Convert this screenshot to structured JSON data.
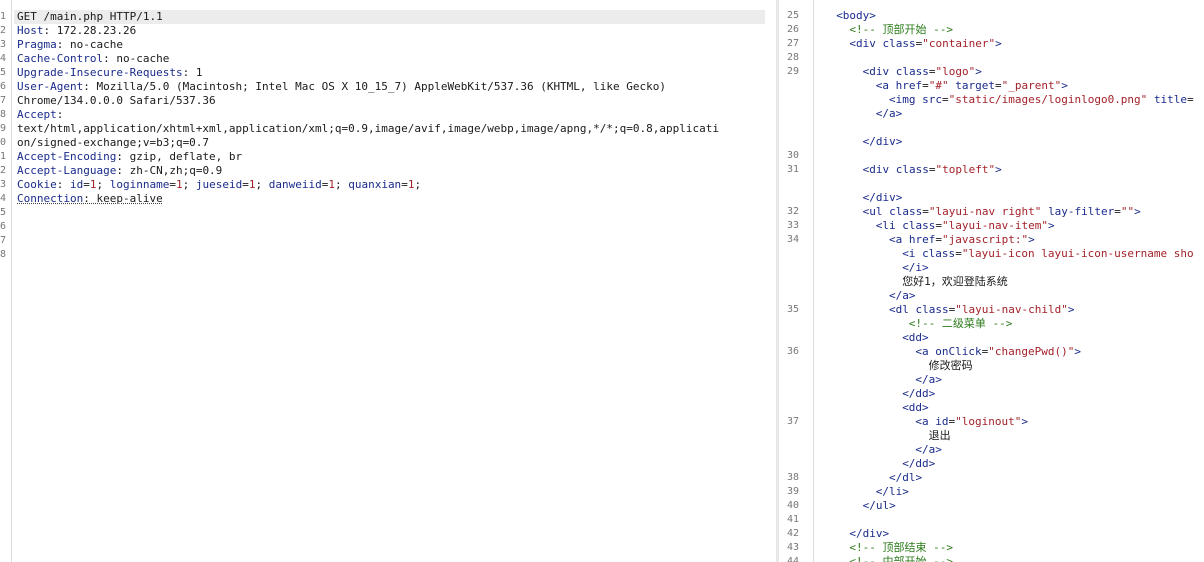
{
  "request": {
    "line_numbers": [
      "1",
      "2",
      "3",
      "4",
      "5",
      "6",
      "7",
      "8",
      "9",
      "0",
      "1",
      "2",
      "3",
      "4",
      "5",
      "6",
      "7",
      "8"
    ],
    "lines": [
      {
        "type": "plain",
        "text": "GET /main.php HTTP/1.1"
      },
      {
        "type": "header",
        "name": "Host",
        "value": " 172.28.23.26"
      },
      {
        "type": "header",
        "name": "Pragma",
        "value": " no-cache"
      },
      {
        "type": "header",
        "name": "Cache-Control",
        "value": " no-cache"
      },
      {
        "type": "header",
        "name": "Upgrade-Insecure-Requests",
        "value": " 1"
      },
      {
        "type": "header",
        "name": "User-Agent",
        "value": " Mozilla/5.0 (Macintosh; Intel Mac OS X 10_15_7) AppleWebKit/537.36 (KHTML, like Gecko)"
      },
      {
        "type": "plain",
        "text": "Chrome/134.0.0.0 Safari/537.36"
      },
      {
        "type": "header",
        "name": "Accept",
        "value": ""
      },
      {
        "type": "plain",
        "text": "text/html,application/xhtml+xml,application/xml;q=0.9,image/avif,image/webp,image/apng,*/*;q=0.8,applicati"
      },
      {
        "type": "plain",
        "text": "on/signed-exchange;v=b3;q=0.7"
      },
      {
        "type": "header",
        "name": "Accept-Encoding",
        "value": " gzip, deflate, br"
      },
      {
        "type": "header",
        "name": "Accept-Language",
        "value": " zh-CN,zh;q=0.9"
      },
      {
        "type": "cookie",
        "name": "Cookie",
        "pairs": [
          {
            "k": "id",
            "v": "1"
          },
          {
            "k": "loginname",
            "v": "1"
          },
          {
            "k": "jueseid",
            "v": "1"
          },
          {
            "k": "danweiid",
            "v": "1"
          },
          {
            "k": "quanxian",
            "v": "1"
          }
        ]
      },
      {
        "type": "header",
        "name": "Connection",
        "value": " keep-alive",
        "underline": true
      }
    ]
  },
  "response": {
    "lines": [
      {
        "n": "25",
        "indent": 2,
        "parts": [
          [
            "t",
            "<body>"
          ]
        ]
      },
      {
        "n": "26",
        "indent": 4,
        "parts": [
          [
            "c",
            "<!-- 顶部开始 -->"
          ]
        ]
      },
      {
        "n": "27",
        "indent": 4,
        "parts": [
          [
            "t",
            "<div "
          ],
          [
            "a",
            "class"
          ],
          [
            "p",
            "="
          ],
          [
            "s",
            "\"container\""
          ],
          [
            "t",
            ">"
          ]
        ]
      },
      {
        "n": "28",
        "indent": 0,
        "parts": []
      },
      {
        "n": "29",
        "indent": 6,
        "parts": [
          [
            "t",
            "<div "
          ],
          [
            "a",
            "class"
          ],
          [
            "p",
            "="
          ],
          [
            "s",
            "\"logo\""
          ],
          [
            "t",
            ">"
          ]
        ]
      },
      {
        "n": "",
        "indent": 8,
        "parts": [
          [
            "t",
            "<a "
          ],
          [
            "a",
            "href"
          ],
          [
            "p",
            "="
          ],
          [
            "s",
            "\"#\""
          ],
          [
            "p",
            " "
          ],
          [
            "a",
            "target"
          ],
          [
            "p",
            "="
          ],
          [
            "s",
            "\"_parent\""
          ],
          [
            "t",
            ">"
          ]
        ]
      },
      {
        "n": "",
        "indent": 10,
        "parts": [
          [
            "t",
            "<img "
          ],
          [
            "a",
            "src"
          ],
          [
            "p",
            "="
          ],
          [
            "s",
            "\"static/images/loginlogo0.png\""
          ],
          [
            "p",
            " "
          ],
          [
            "a",
            "title"
          ],
          [
            "p",
            "="
          ]
        ]
      },
      {
        "n": "",
        "indent": 8,
        "parts": [
          [
            "t",
            "</a>"
          ]
        ]
      },
      {
        "n": "",
        "indent": 0,
        "parts": []
      },
      {
        "n": "",
        "indent": 6,
        "parts": [
          [
            "t",
            "</div>"
          ]
        ]
      },
      {
        "n": "30",
        "indent": 0,
        "parts": []
      },
      {
        "n": "31",
        "indent": 6,
        "parts": [
          [
            "t",
            "<div "
          ],
          [
            "a",
            "class"
          ],
          [
            "p",
            "="
          ],
          [
            "s",
            "\"topleft\""
          ],
          [
            "t",
            ">"
          ]
        ]
      },
      {
        "n": "",
        "indent": 0,
        "parts": []
      },
      {
        "n": "",
        "indent": 6,
        "parts": [
          [
            "t",
            "</div>"
          ]
        ]
      },
      {
        "n": "32",
        "indent": 6,
        "parts": [
          [
            "t",
            "<ul "
          ],
          [
            "a",
            "class"
          ],
          [
            "p",
            "="
          ],
          [
            "s",
            "\"layui-nav right\""
          ],
          [
            "p",
            " "
          ],
          [
            "a",
            "lay-filter"
          ],
          [
            "p",
            "="
          ],
          [
            "s",
            "\"\""
          ],
          [
            "t",
            ">"
          ]
        ]
      },
      {
        "n": "33",
        "indent": 8,
        "parts": [
          [
            "t",
            "<li "
          ],
          [
            "a",
            "class"
          ],
          [
            "p",
            "="
          ],
          [
            "s",
            "\"layui-nav-item\""
          ],
          [
            "t",
            ">"
          ]
        ]
      },
      {
        "n": "34",
        "indent": 10,
        "parts": [
          [
            "t",
            "<a "
          ],
          [
            "a",
            "href"
          ],
          [
            "p",
            "="
          ],
          [
            "s",
            "\"javascript:\""
          ],
          [
            "t",
            ">"
          ]
        ]
      },
      {
        "n": "",
        "indent": 12,
        "parts": [
          [
            "t",
            "<i "
          ],
          [
            "a",
            "class"
          ],
          [
            "p",
            "="
          ],
          [
            "s",
            "\"layui-icon layui-icon-username sho"
          ]
        ]
      },
      {
        "n": "",
        "indent": 12,
        "parts": [
          [
            "t",
            "</i>"
          ]
        ]
      },
      {
        "n": "",
        "indent": 12,
        "parts": [
          [
            "p",
            "您好1，欢迎登陆系统"
          ]
        ]
      },
      {
        "n": "",
        "indent": 10,
        "parts": [
          [
            "t",
            "</a>"
          ]
        ]
      },
      {
        "n": "35",
        "indent": 10,
        "parts": [
          [
            "t",
            "<dl "
          ],
          [
            "a",
            "class"
          ],
          [
            "p",
            "="
          ],
          [
            "s",
            "\"layui-nav-child\""
          ],
          [
            "t",
            ">"
          ]
        ]
      },
      {
        "n": "",
        "indent": 13,
        "parts": [
          [
            "c",
            "<!-- 二级菜单 -->"
          ]
        ]
      },
      {
        "n": "",
        "indent": 12,
        "parts": [
          [
            "t",
            "<dd>"
          ]
        ]
      },
      {
        "n": "36",
        "indent": 14,
        "parts": [
          [
            "t",
            "<a "
          ],
          [
            "a",
            "onClick"
          ],
          [
            "p",
            "="
          ],
          [
            "s",
            "\"changePwd()\""
          ],
          [
            "t",
            ">"
          ]
        ]
      },
      {
        "n": "",
        "indent": 16,
        "parts": [
          [
            "p",
            "修改密码"
          ]
        ]
      },
      {
        "n": "",
        "indent": 14,
        "parts": [
          [
            "t",
            "</a>"
          ]
        ]
      },
      {
        "n": "",
        "indent": 12,
        "parts": [
          [
            "t",
            "</dd>"
          ]
        ]
      },
      {
        "n": "",
        "indent": 12,
        "parts": [
          [
            "t",
            "<dd>"
          ]
        ]
      },
      {
        "n": "37",
        "indent": 14,
        "parts": [
          [
            "t",
            "<a "
          ],
          [
            "a",
            "id"
          ],
          [
            "p",
            "="
          ],
          [
            "s",
            "\"loginout\""
          ],
          [
            "t",
            ">"
          ]
        ]
      },
      {
        "n": "",
        "indent": 16,
        "parts": [
          [
            "p",
            "退出"
          ]
        ]
      },
      {
        "n": "",
        "indent": 14,
        "parts": [
          [
            "t",
            "</a>"
          ]
        ]
      },
      {
        "n": "",
        "indent": 12,
        "parts": [
          [
            "t",
            "</dd>"
          ]
        ]
      },
      {
        "n": "38",
        "indent": 10,
        "parts": [
          [
            "t",
            "</dl>"
          ]
        ]
      },
      {
        "n": "39",
        "indent": 8,
        "parts": [
          [
            "t",
            "</li>"
          ]
        ]
      },
      {
        "n": "40",
        "indent": 6,
        "parts": [
          [
            "t",
            "</ul>"
          ]
        ]
      },
      {
        "n": "41",
        "indent": 0,
        "parts": []
      },
      {
        "n": "42",
        "indent": 4,
        "parts": [
          [
            "t",
            "</div>"
          ]
        ]
      },
      {
        "n": "43",
        "indent": 4,
        "parts": [
          [
            "c",
            "<!-- 顶部结束 -->"
          ]
        ]
      },
      {
        "n": "44",
        "indent": 4,
        "parts": [
          [
            "c",
            "<!-- 中部开始 -->"
          ]
        ]
      }
    ]
  }
}
